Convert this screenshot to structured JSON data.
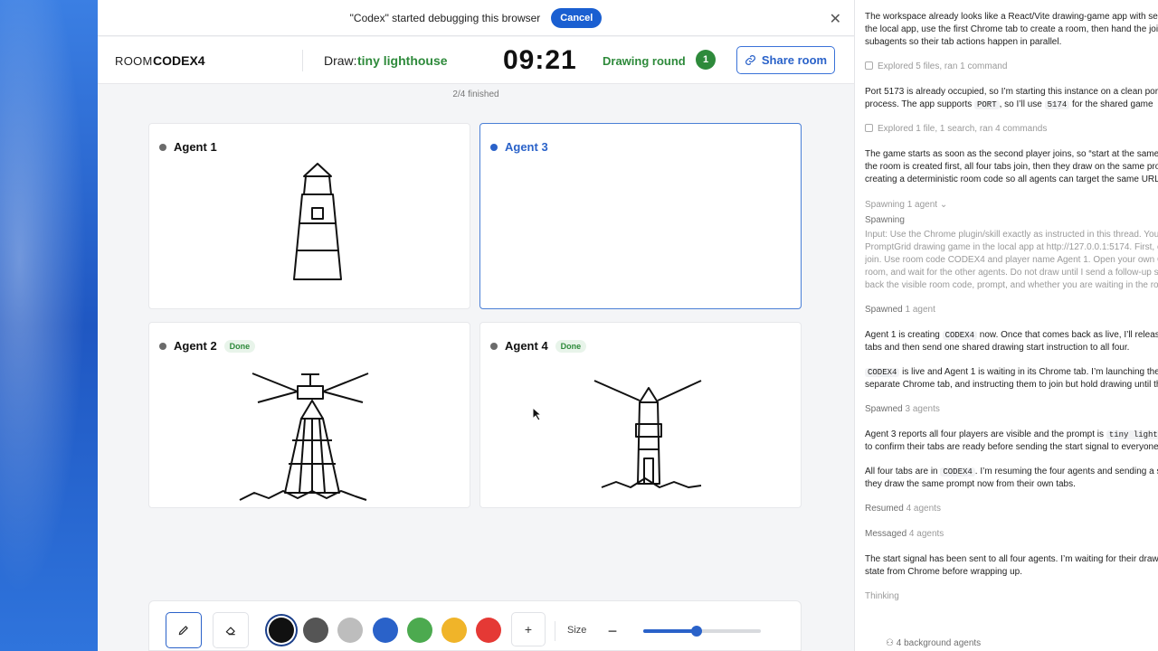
{
  "debug_bar": {
    "message": "\"Codex\" started debugging this browser",
    "cancel_label": "Cancel",
    "close_icon": "close-icon"
  },
  "header": {
    "room_label": "ROOM",
    "room_code": "CODEX4",
    "draw_label": "Draw:",
    "prompt": "tiny lighthouse",
    "timer": "09:21",
    "round_label": "Drawing round",
    "round_number": "1",
    "share_label": "Share room",
    "share_icon": "link-icon"
  },
  "progress_text": "2/4 finished",
  "cards": [
    {
      "name": "Agent 1",
      "status": "",
      "active": false
    },
    {
      "name": "Agent 3",
      "status": "",
      "active": true
    },
    {
      "name": "Agent 2",
      "status": "Done",
      "active": false
    },
    {
      "name": "Agent 4",
      "status": "Done",
      "active": false
    }
  ],
  "toolbar": {
    "pen_icon": "pencil-icon",
    "eraser_icon": "eraser-icon",
    "colors": [
      "#111111",
      "#555555",
      "#bdbdbd",
      "#2a62c9",
      "#4caa4f",
      "#f0b429",
      "#e53935"
    ],
    "selected_color": "#111111",
    "add_color_label": "+",
    "size_label": "Size",
    "minus_label": "−",
    "size_value_fraction": 0.45
  },
  "panel": {
    "p1_line1": "The workspace already looks like a React/Vite drawing-game app with ser",
    "p1_line2": "the local app, use the first Chrome tab to create a room, then hand the joi",
    "p1_line3": "subagents so their tab actions happen in parallel.",
    "explored1": "Explored 5 files, ran 1 command",
    "p2_line1": "Port 5173 is already occupied, so I’m starting this instance on a clean port",
    "p2_line2_a": "process. The app supports ",
    "p2_code1": "PORT",
    "p2_line2_b": ", so I’ll use ",
    "p2_code2": "5174",
    "p2_line2_c": " for the shared game",
    "explored2": "Explored 1 file, 1 search, ran 4 commands",
    "p3_line1": "The game starts as soon as the second player joins, so “start at the same",
    "p3_line2": "the room is created first, all four tabs join, then they draw on the same pro",
    "p3_line3": "creating a deterministic room code so all agents can target the same URL",
    "spawning_toggle": "Spawning 1 agent ⌄",
    "spawning_title": "Spawning",
    "input_line1": "Input: Use the Chrome plugin/skill exactly as instructed in this thread. You",
    "input_line2": "PromptGrid drawing game in the local app at http://127.0.0.1:5174. First, cr",
    "input_line3": "join. Use room code CODEX4 and player name Agent 1. Open your own Ch",
    "input_line4": "room, and wait for the other agents. Do not draw until I send a follow-up s",
    "input_line5": "back the visible room code, prompt, and whether you are waiting in the ro",
    "spawned1_a": "Spawned",
    "spawned1_b": "1 agent",
    "p4_line1_a": "Agent 1 is creating ",
    "p4_code": "CODEX4",
    "p4_line1_b": " now. Once that comes back as live, I’ll releas",
    "p4_line2": "tabs and then send one shared drawing start instruction to all four.",
    "p5_code": "CODEX4",
    "p5_line1_b": " is live and Agent 1 is waiting in its Chrome tab. I’m launching the",
    "p5_line2": "separate Chrome tab, and instructing them to join but hold drawing until th",
    "spawned3_a": "Spawned",
    "spawned3_b": "3 agents",
    "p6_line1_a": "Agent 3 reports all four players are visible and the prompt is ",
    "p6_code": "tiny light",
    "p6_line2": "to confirm their tabs are ready before sending the start signal to everyone",
    "p7_line1_a": "All four tabs are in ",
    "p7_code": "CODEX4",
    "p7_line1_b": ". I’m resuming the four agents and sending a s",
    "p7_line2": "they draw the same prompt now from their own tabs.",
    "resumed_a": "Resumed",
    "resumed_b": "4 agents",
    "messaged_a": "Messaged",
    "messaged_b": "4 agents",
    "p8_line1": "The start signal has been sent to all four agents. I’m waiting for their draw",
    "p8_line2": "state from Chrome before wrapping up.",
    "thinking": "Thinking",
    "background_agents": "4 background agents"
  }
}
